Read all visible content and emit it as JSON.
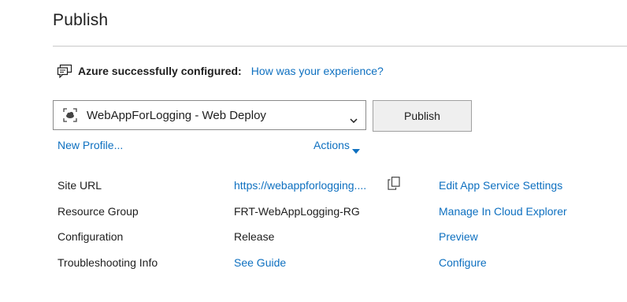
{
  "header": {
    "title": "Publish"
  },
  "banner": {
    "icon": "feedback-icon",
    "status": "Azure successfully configured:",
    "feedback_link": "How was your experience?"
  },
  "profile": {
    "icon": "web-deploy-icon",
    "selected": "WebAppForLogging - Web Deploy",
    "dropdown_icon": "chevron-down-icon"
  },
  "publish_button": {
    "label": "Publish"
  },
  "links": {
    "new_profile": "New Profile...",
    "actions": "Actions"
  },
  "details": {
    "site_url": {
      "label": "Site URL",
      "value": "https://webappforlogging....",
      "copy_icon": "copy-icon",
      "action": "Edit App Service Settings"
    },
    "resource_group": {
      "label": "Resource Group",
      "value": "FRT-WebAppLogging-RG",
      "action": "Manage In Cloud Explorer"
    },
    "configuration": {
      "label": "Configuration",
      "value": "Release",
      "action": "Preview"
    },
    "troubleshooting": {
      "label": "Troubleshooting Info",
      "value": "See Guide",
      "action": "Configure"
    }
  },
  "colors": {
    "link": "#0e70c0",
    "text": "#1e1e1e",
    "button_bg": "#efefef",
    "rule": "#c8c8c8"
  }
}
